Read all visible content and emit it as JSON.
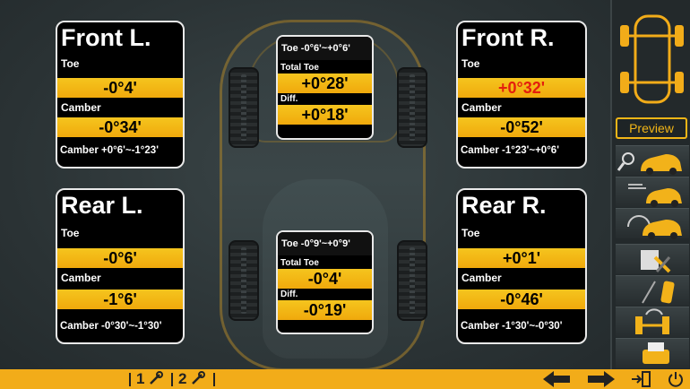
{
  "front_left": {
    "title": "Front L.",
    "toe_label": "Toe",
    "toe_value": "-0°4'",
    "camber_label": "Camber",
    "camber_value": "-0°34'",
    "range": "Camber +0°6'~-1°23'"
  },
  "front_right": {
    "title": "Front R.",
    "toe_label": "Toe",
    "toe_value": "+0°32'",
    "camber_label": "Camber",
    "camber_value": "-0°52'",
    "range": "Camber -1°23'~+0°6'"
  },
  "rear_left": {
    "title": "Rear L.",
    "toe_label": "Toe",
    "toe_value": "-0°6'",
    "camber_label": "Camber",
    "camber_value": "-1°6'",
    "range": "Camber -0°30'~-1°30'"
  },
  "rear_right": {
    "title": "Rear R.",
    "toe_label": "Toe",
    "toe_value": "+0°1'",
    "camber_label": "Camber",
    "camber_value": "-0°46'",
    "range": "Camber -1°30'~-0°30'"
  },
  "front_center": {
    "range": "Toe -0°6'~+0°6'",
    "total_toe_label": "Total Toe",
    "total_toe_value": "+0°28'",
    "diff_label": "Diff.",
    "diff_value": "+0°18'"
  },
  "rear_center": {
    "range": "Toe -0°9'~+0°9'",
    "total_toe_label": "Total Toe",
    "total_toe_value": "-0°4'",
    "diff_label": "Diff.",
    "diff_value": "-0°19'"
  },
  "sidebar": {
    "preview_label": "Preview",
    "icons": [
      "wrench-car-icon",
      "lift-car-icon",
      "gauge-car-icon",
      "tools-icon",
      "camber-adjust-icon",
      "axle-adjust-icon",
      "printer-icon"
    ]
  },
  "bottom": {
    "step1": "1",
    "step2": "2"
  },
  "colors": {
    "accent": "#f2ac19",
    "value_red": "#e41e0d",
    "panel_bg": "#000000"
  }
}
